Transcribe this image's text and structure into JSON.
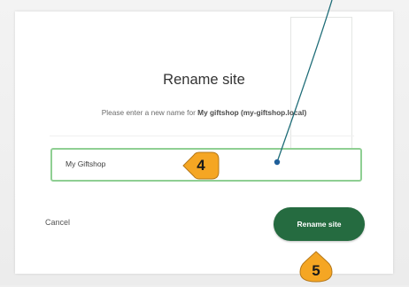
{
  "dialog": {
    "title": "Rename site",
    "subtitle_prefix": "Please enter a new name for ",
    "subtitle_site": "My giftshop (my-giftshop.local)"
  },
  "name_input": {
    "value": "My Giftshop"
  },
  "actions": {
    "cancel_label": "Cancel",
    "rename_label": "Rename site"
  },
  "callouts": {
    "step_4": "4",
    "step_5": "5"
  },
  "colors": {
    "primary_button": "#256b40",
    "input_border_focus": "#8fcf93",
    "callout_fill": "#f5a623",
    "connector_line": "#1f6d78"
  },
  "icons": {
    "callout_marker": "callout-marker-icon",
    "connector_dot": "connector-dot-icon"
  }
}
